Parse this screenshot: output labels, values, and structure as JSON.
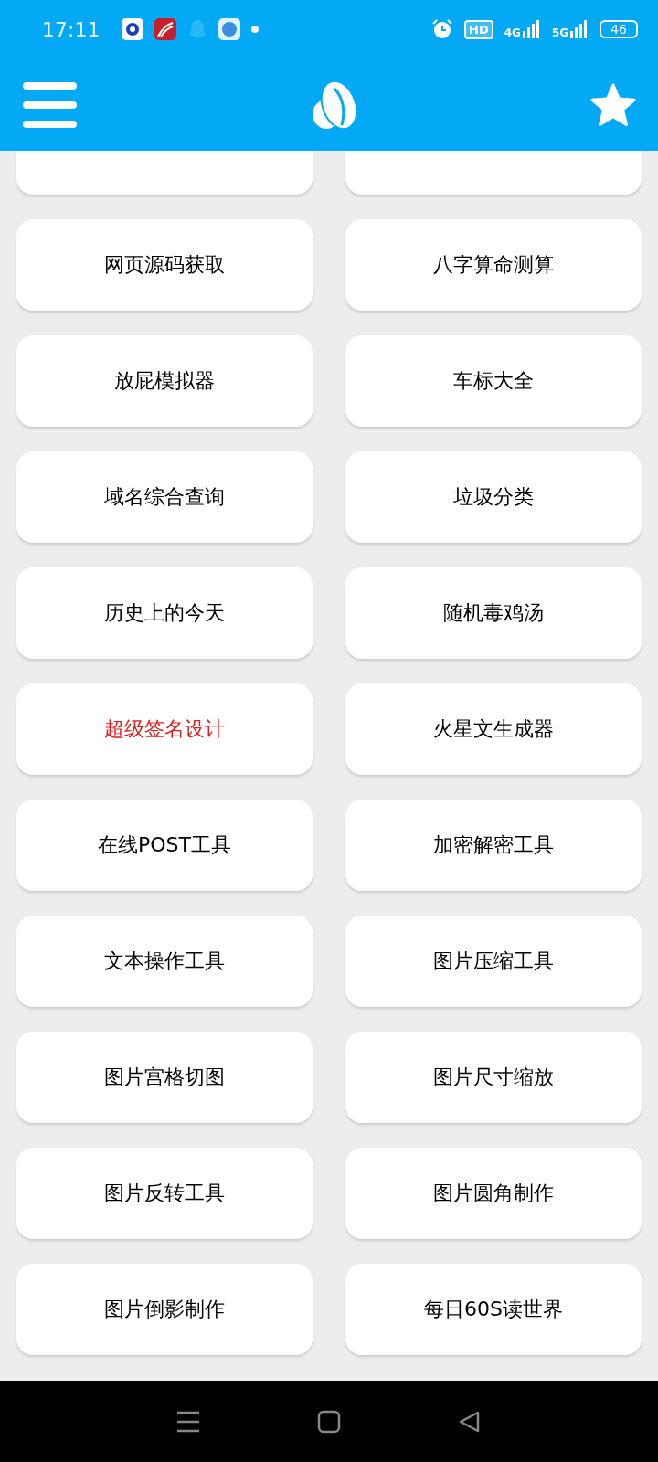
{
  "status_bar": {
    "time": "17:11",
    "hd": "HD",
    "network_1": "4G",
    "network_2": "5G",
    "battery": "46"
  },
  "tools": [
    {
      "label": "网页源码获取",
      "color": "#000000"
    },
    {
      "label": "八字算命测算",
      "color": "#000000"
    },
    {
      "label": "放屁模拟器",
      "color": "#000000"
    },
    {
      "label": "车标大全",
      "color": "#000000"
    },
    {
      "label": "域名综合查询",
      "color": "#000000"
    },
    {
      "label": "垃圾分类",
      "color": "#000000"
    },
    {
      "label": "历史上的今天",
      "color": "#000000"
    },
    {
      "label": "随机毒鸡汤",
      "color": "#000000"
    },
    {
      "label": "超级签名设计",
      "color": "#dd1f1f"
    },
    {
      "label": "火星文生成器",
      "color": "#000000"
    },
    {
      "label": "在线POST工具",
      "color": "#000000"
    },
    {
      "label": "加密解密工具",
      "color": "#000000"
    },
    {
      "label": "文本操作工具",
      "color": "#000000"
    },
    {
      "label": "图片压缩工具",
      "color": "#000000"
    },
    {
      "label": "图片宫格切图",
      "color": "#000000"
    },
    {
      "label": "图片尺寸缩放",
      "color": "#000000"
    },
    {
      "label": "图片反转工具",
      "color": "#000000"
    },
    {
      "label": "图片圆角制作",
      "color": "#000000"
    },
    {
      "label": "图片倒影制作",
      "color": "#000000"
    },
    {
      "label": "每日60S读世界",
      "color": "#000000"
    }
  ]
}
